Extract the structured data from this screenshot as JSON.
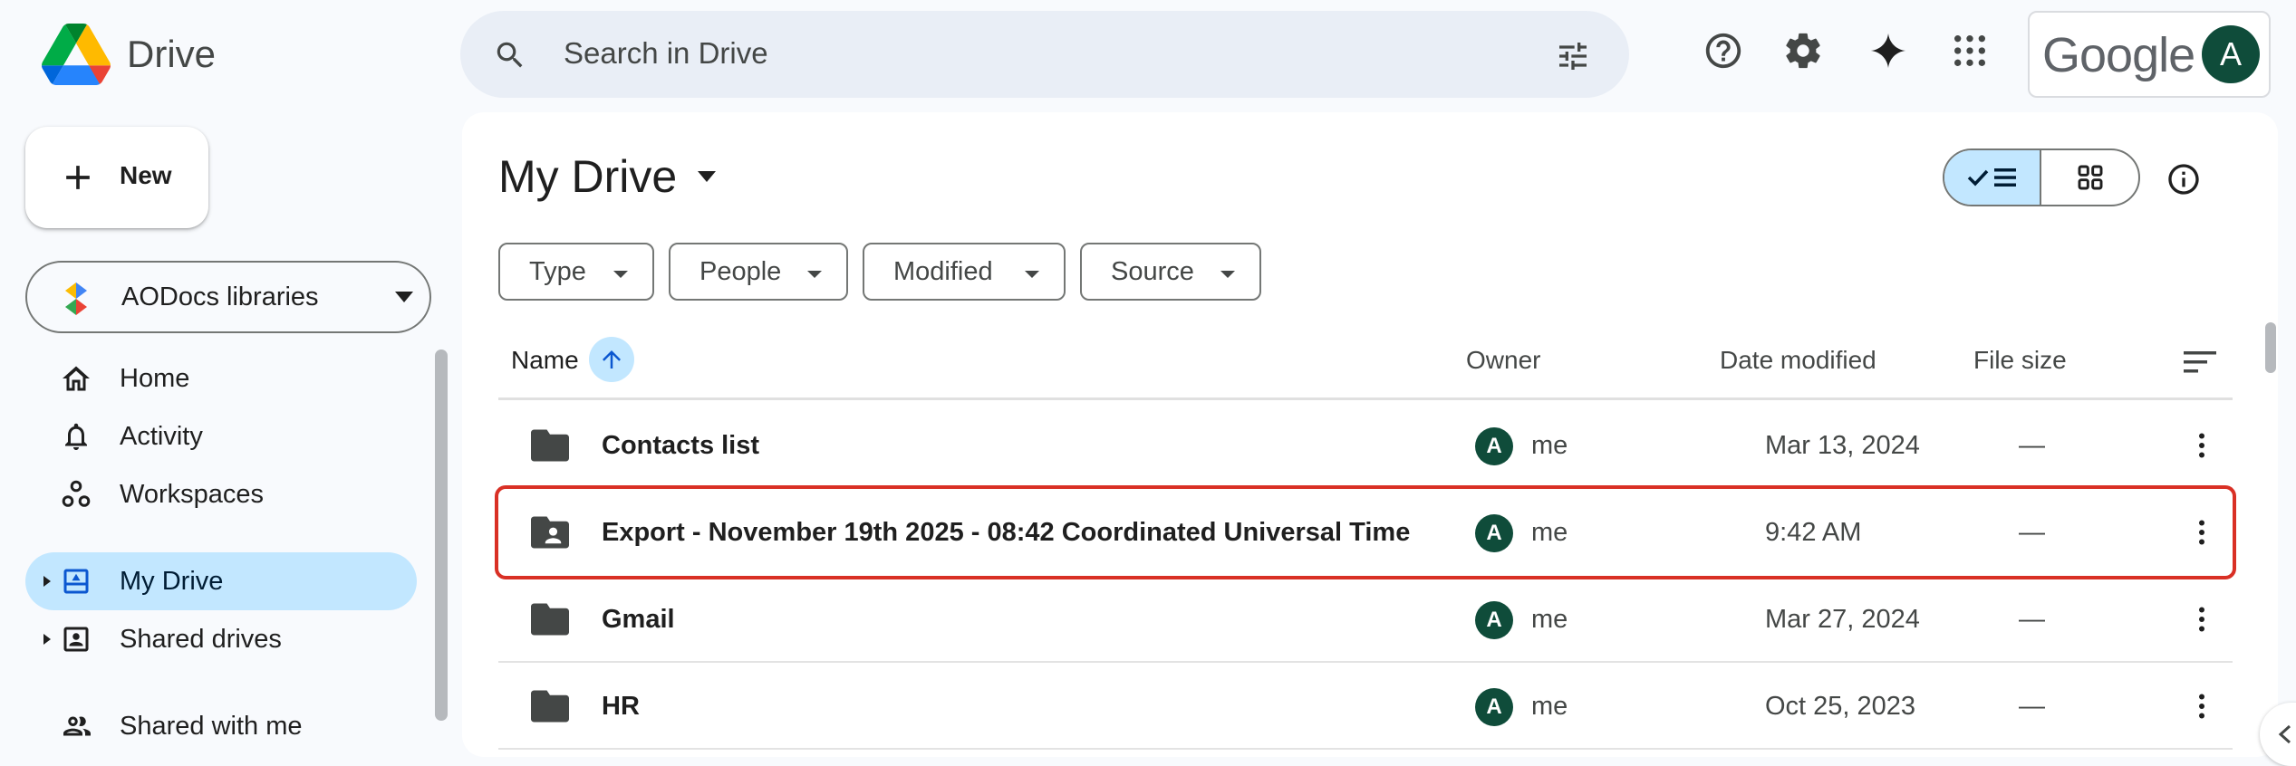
{
  "app": {
    "name": "Drive"
  },
  "search": {
    "placeholder": "Search in Drive"
  },
  "account": {
    "google_label": "Google",
    "avatar_letter": "A"
  },
  "sidebar": {
    "new_label": "New",
    "aodocs_label": "AODocs libraries",
    "items": [
      {
        "label": "Home",
        "icon": "home-icon",
        "active": false
      },
      {
        "label": "Activity",
        "icon": "bell-icon",
        "active": false
      },
      {
        "label": "Workspaces",
        "icon": "workspaces-icon",
        "active": false
      },
      {
        "label": "My Drive",
        "icon": "my-drive-icon",
        "active": true
      },
      {
        "label": "Shared drives",
        "icon": "shared-drives-icon",
        "active": false
      },
      {
        "label": "Shared with me",
        "icon": "people-icon",
        "active": false
      }
    ]
  },
  "main": {
    "title": "My Drive",
    "view_mode": "list",
    "filters": [
      "Type",
      "People",
      "Modified",
      "Source"
    ],
    "columns": {
      "name": "Name",
      "owner": "Owner",
      "date": "Date modified",
      "size": "File size"
    },
    "sort": {
      "column": "Name",
      "direction": "ascending"
    },
    "rows": [
      {
        "name": "Contacts list",
        "type": "folder",
        "owner_avatar": "A",
        "owner": "me",
        "date": "Mar 13, 2024",
        "size": "—",
        "highlighted": false
      },
      {
        "name": "Export - November 19th 2025 - 08:42 Coordinated Universal Time",
        "type": "shared-folder",
        "owner_avatar": "A",
        "owner": "me",
        "date": "9:42 AM",
        "size": "—",
        "highlighted": true
      },
      {
        "name": "Gmail",
        "type": "folder",
        "owner_avatar": "A",
        "owner": "me",
        "date": "Mar 27, 2024",
        "size": "—",
        "highlighted": false
      },
      {
        "name": "HR",
        "type": "folder",
        "owner_avatar": "A",
        "owner": "me",
        "date": "Oct 25, 2023",
        "size": "—",
        "highlighted": false
      }
    ]
  },
  "colors": {
    "accent": "#c2e7ff",
    "highlight_border": "#d93025",
    "avatar": "#0f4c3a",
    "background": "#f8fafd"
  }
}
